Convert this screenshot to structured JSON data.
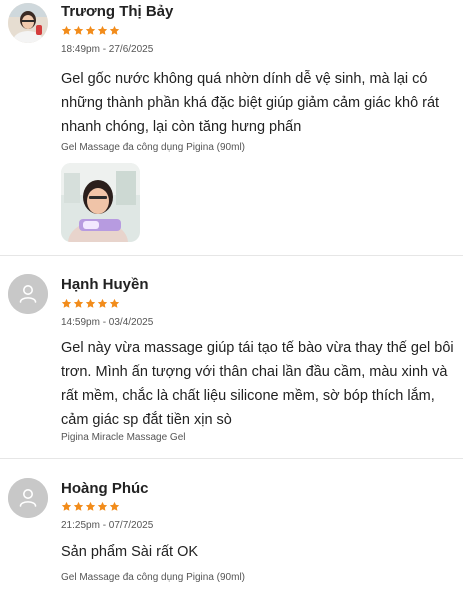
{
  "reviews": [
    {
      "name": "Trương Thị Bảy",
      "rating": 5,
      "time": "18:49pm - 27/6/2025",
      "content": "Gel gốc nước không quá nhờn dính dễ vệ sinh, mà lại có những thành phần khá đặc biệt giúp giảm cảm giác khô rát nhanh chóng, lại còn tăng hưng phấn",
      "product": "Gel Massage đa công dụng Pigina (90ml)",
      "has_photo_avatar": true,
      "has_attached_image": true
    },
    {
      "name": "Hạnh Huyền",
      "rating": 5,
      "time": "14:59pm - 03/4/2025",
      "content": "Gel này vừa massage giúp tái tạo tế bào vừa thay thế gel bôi trơn. Mình ấn tượng với thân chai lần đầu cầm, màu xinh và rất mềm, chắc là chất liệu silicone mềm, sờ bóp thích lắm, cảm giác sp đắt tiền xịn sò",
      "product": "Pigina Miracle Massage Gel",
      "has_photo_avatar": false,
      "has_attached_image": false
    },
    {
      "name": "Hoàng Phúc",
      "rating": 5,
      "time": "21:25pm - 07/7/2025",
      "content": "Sản phẩm Sài rất OK",
      "product": "Gel Massage đa công dụng Pigina (90ml)",
      "has_photo_avatar": false,
      "has_attached_image": false
    }
  ],
  "colors": {
    "star": "#f28c1b",
    "default_avatar_bg": "#c8c8c8",
    "divider": "#e6e6e6"
  },
  "icons": {
    "star": "star-icon",
    "default_avatar": "user-icon"
  }
}
